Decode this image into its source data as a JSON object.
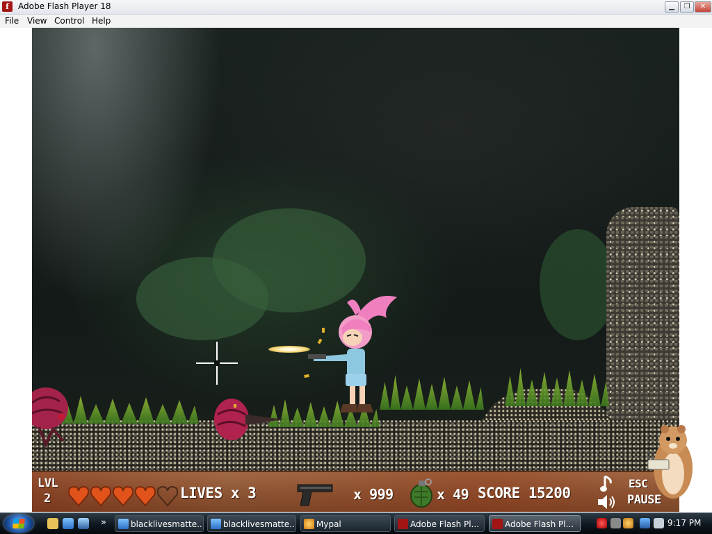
{
  "window": {
    "title": "Adobe Flash Player 18",
    "icon": "flash-icon",
    "controls": [
      "minimize-icon",
      "maximize-icon",
      "close-icon"
    ]
  },
  "menu": {
    "items": [
      "File",
      "View",
      "Control",
      "Help"
    ]
  },
  "hud": {
    "level_label": "LVL",
    "level_value": "2",
    "hearts": {
      "total": 5,
      "filled": 4,
      "color": "#e2531c"
    },
    "lives_text": "LIVES x 3",
    "weapon_icon": "pistol-icon",
    "ammo_text": "x 999",
    "grenade_icon": "grenade-icon",
    "grenades_text": "x 49",
    "score_text": "SCORE 15200",
    "music_icon": "music-note-icon",
    "sound_icon": "speaker-icon",
    "esc_text": "ESC",
    "pause_text": "PAUSE"
  },
  "taskbar": {
    "tasks": [
      {
        "label": "blacklivesmatte...",
        "icon": "ie-icon",
        "active": false
      },
      {
        "label": "blacklivesmatte...",
        "icon": "ie-icon",
        "active": false
      },
      {
        "label": "Mypal",
        "icon": "mypal-icon",
        "active": false
      },
      {
        "label": "Adobe Flash Pl...",
        "icon": "flash-icon",
        "active": false
      },
      {
        "label": "Adobe Flash Pl...",
        "icon": "flash-icon",
        "active": true
      }
    ],
    "clock": "9:17 PM"
  }
}
